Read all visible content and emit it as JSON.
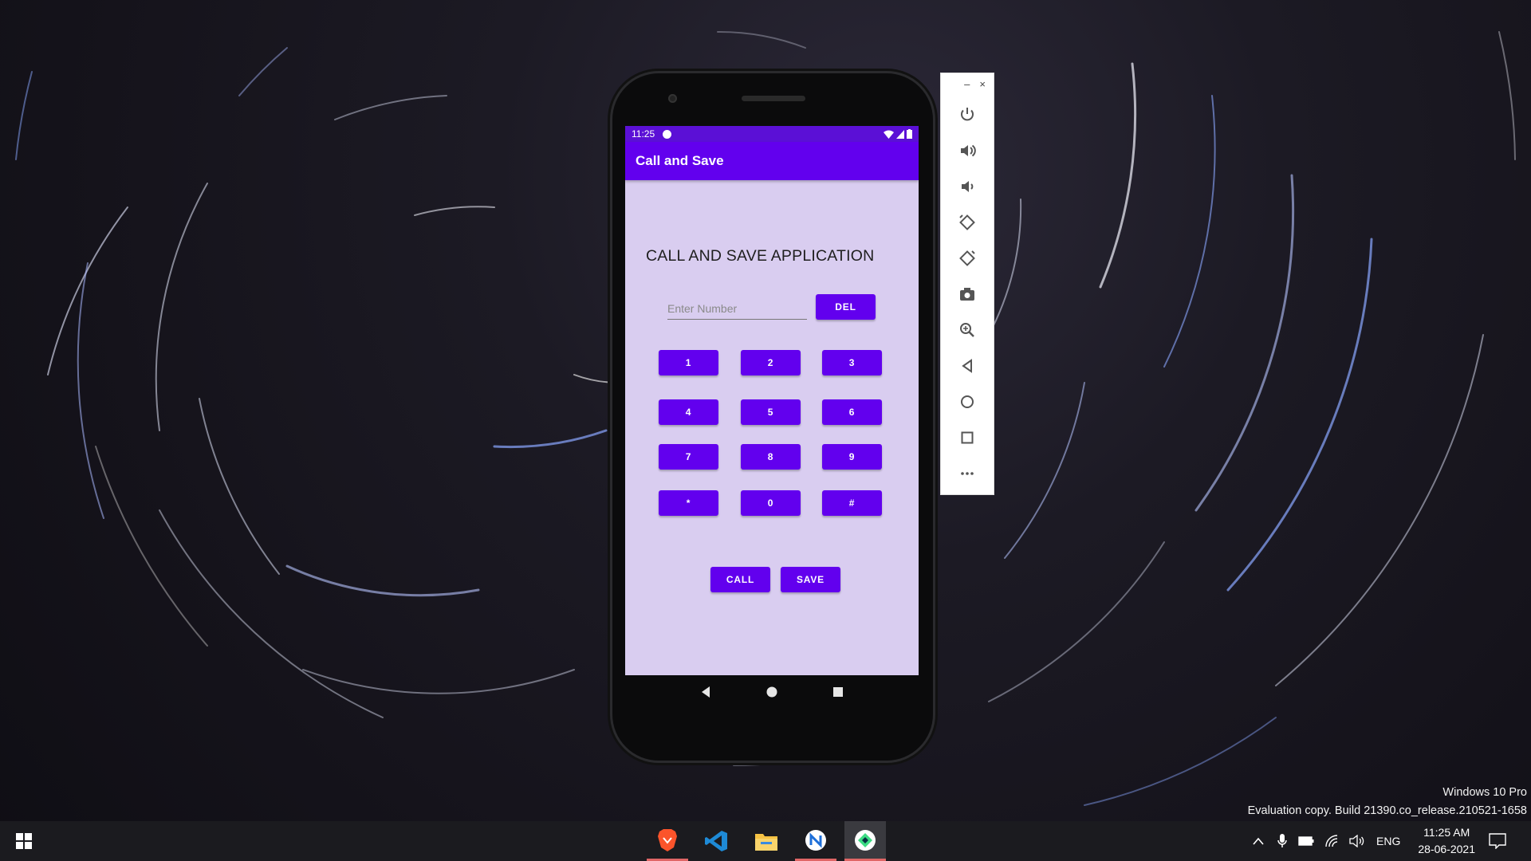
{
  "phone": {
    "status_time": "11:25",
    "app_title": "Call and Save",
    "heading": "CALL AND SAVE APPLICATION",
    "number_input": {
      "value": "",
      "placeholder": "Enter Number"
    },
    "del_label": "DEL",
    "keys": [
      "1",
      "2",
      "3",
      "4",
      "5",
      "6",
      "7",
      "8",
      "9",
      "*",
      "0",
      "#"
    ],
    "call_label": "CALL",
    "save_label": "SAVE"
  },
  "emulator_toolbar": {
    "minimize": "–",
    "close": "×",
    "buttons": [
      "power-icon",
      "volume-up-icon",
      "volume-down-icon",
      "rotate-left-icon",
      "rotate-right-icon",
      "camera-icon",
      "zoom-icon",
      "back-icon",
      "home-icon",
      "overview-icon",
      "more-icon"
    ]
  },
  "watermark": {
    "line1": "Windows 10 Pro",
    "line2": "Evaluation copy. Build 21390.co_release.210521-1658"
  },
  "taskbar": {
    "apps": [
      "brave-icon",
      "vscode-icon",
      "file-explorer-icon",
      "app-n-icon",
      "android-studio-icon"
    ],
    "language": "ENG",
    "time": "11:25 AM",
    "date": "28-06-2021"
  },
  "colors": {
    "accent": "#6200ee",
    "status_bar": "#5b10d6",
    "screen_bg": "#d9cdf0"
  }
}
